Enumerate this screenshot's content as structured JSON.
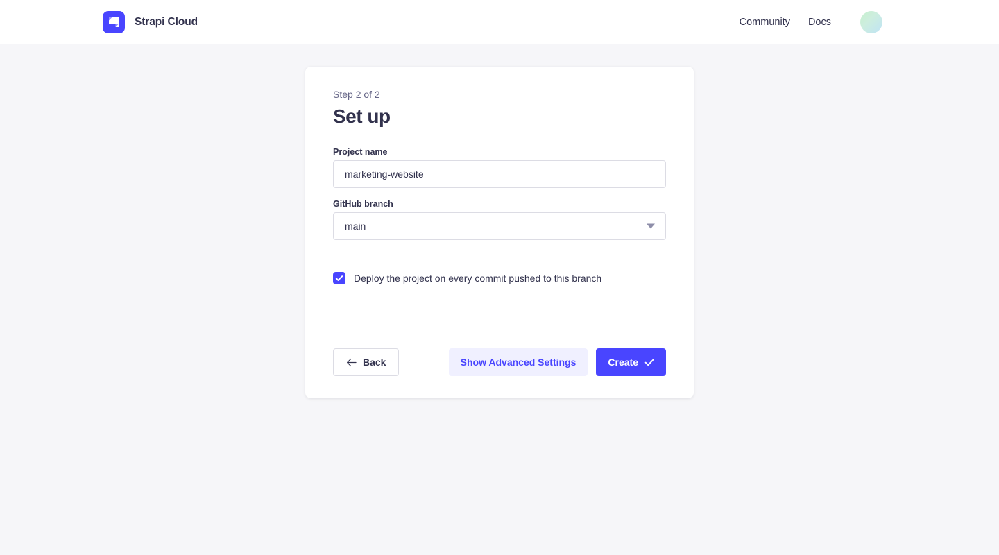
{
  "header": {
    "brand_name": "Strapi Cloud",
    "logo_icon": "strapi-logo-icon",
    "nav": [
      {
        "label": "Community"
      },
      {
        "label": "Docs"
      }
    ],
    "avatar_icon": "user-avatar"
  },
  "card": {
    "step_label": "Step 2 of 2",
    "title": "Set up",
    "fields": {
      "project_name": {
        "label": "Project name",
        "value": "marketing-website",
        "placeholder": "Project name"
      },
      "github_branch": {
        "label": "GitHub branch",
        "value": "main",
        "caret_icon": "chevron-down-icon"
      }
    },
    "checkbox": {
      "label": "Deploy the project on every commit pushed to this branch",
      "checked": true,
      "check_icon": "check-icon"
    },
    "buttons": {
      "back": {
        "label": "Back",
        "icon": "arrow-left-icon"
      },
      "advanced": {
        "label": "Show Advanced Settings"
      },
      "create": {
        "label": "Create",
        "icon": "check-icon"
      }
    }
  },
  "colors": {
    "accent": "#4945ff",
    "accent_soft": "#f0f0ff",
    "page_bg": "#f6f6f9",
    "text": "#32324d",
    "muted": "#666687",
    "border": "#dcdce4"
  }
}
